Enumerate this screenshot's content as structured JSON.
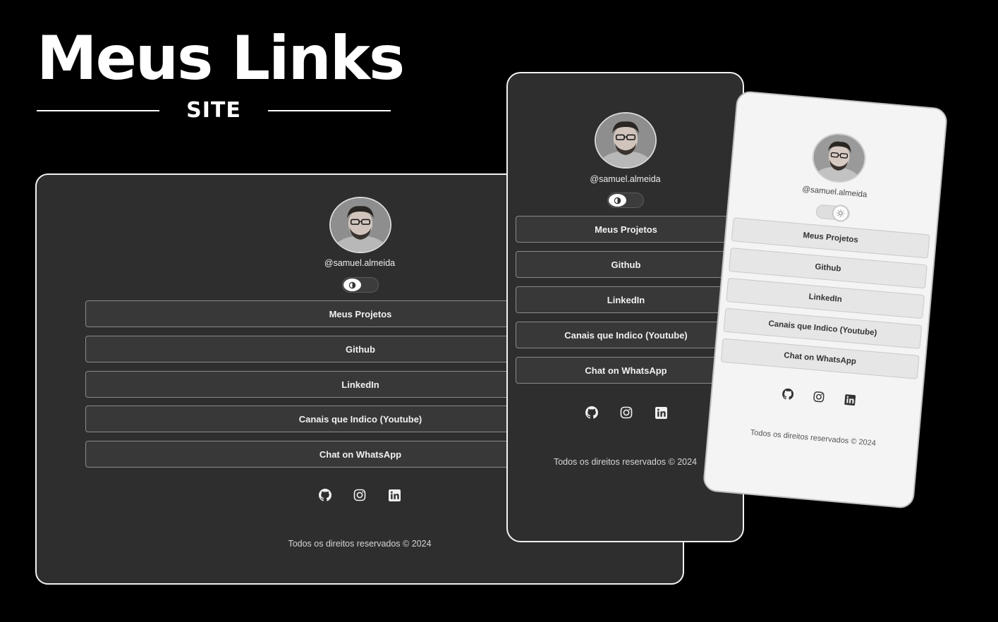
{
  "hero": {
    "title": "Meus Links",
    "subtitle": "SITE"
  },
  "profile": {
    "username": "@samuel.almeida",
    "avatar_icon": "profile-photo"
  },
  "links": [
    {
      "label": "Meus Projetos"
    },
    {
      "label": "Github"
    },
    {
      "label": "LinkedIn"
    },
    {
      "label": "Canais que Indico (Youtube)"
    },
    {
      "label": "Chat on WhatsApp"
    }
  ],
  "social": [
    {
      "icon": "github-icon"
    },
    {
      "icon": "instagram-icon"
    },
    {
      "icon": "linkedin-icon"
    }
  ],
  "theme_toggle": {
    "dark_icon": "moon-icon",
    "light_icon": "sun-icon"
  },
  "footer": {
    "text": "Todos os direitos reservados © 2024"
  },
  "colors": {
    "page_background": "#000000",
    "dark_card": "#2e2e2e",
    "dark_button": "#383838",
    "light_card": "#f4f4f4",
    "light_button": "#e6e6e6"
  }
}
